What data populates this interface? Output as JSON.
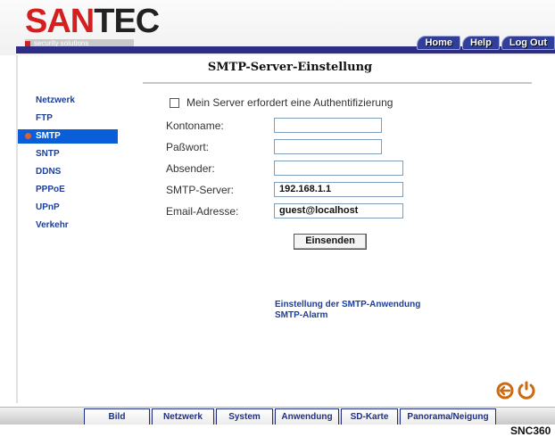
{
  "brand": {
    "logo_part1": "SAN",
    "logo_part2": "TEC",
    "tagline": "security solutions"
  },
  "top_nav": [
    {
      "label": "Home"
    },
    {
      "label": "Help"
    },
    {
      "label": "Log Out"
    }
  ],
  "page": {
    "title": "SMTP-Server-Einstellung"
  },
  "sidebar": {
    "items": [
      {
        "label": "Netzwerk"
      },
      {
        "label": "FTP"
      },
      {
        "label": "SMTP",
        "active": true
      },
      {
        "label": "SNTP"
      },
      {
        "label": "DDNS"
      },
      {
        "label": "PPPoE"
      },
      {
        "label": "UPnP"
      },
      {
        "label": "Verkehr"
      }
    ]
  },
  "form": {
    "auth_label": "Mein Server erfordert eine Authentifizierung",
    "auth_checked": false,
    "fields": [
      {
        "label": "Kontoname:",
        "value": ""
      },
      {
        "label": "Paßwort:",
        "value": ""
      },
      {
        "label": "Absender:",
        "value": ""
      },
      {
        "label": "SMTP-Server:",
        "value": "192.168.1.1"
      },
      {
        "label": "Email-Adresse:",
        "value": "guest@localhost"
      }
    ],
    "submit_label": "Einsenden"
  },
  "links": {
    "app": "Einstellung der SMTP-Anwendung",
    "alarm": "SMTP-Alarm"
  },
  "bottom_nav": [
    {
      "label": "Bild"
    },
    {
      "label": "Netzwerk"
    },
    {
      "label": "System"
    },
    {
      "label": "Anwendung"
    },
    {
      "label": "SD-Karte"
    },
    {
      "label": "Panorama/Neigung"
    }
  ],
  "model": "SNC360",
  "icons": {
    "back": "back-arrow-icon",
    "refresh": "refresh-icon"
  },
  "colors": {
    "accent_red": "#d51f1f",
    "link_blue": "#1c3e9c",
    "active_blue": "#0a5fd8",
    "nav_dark": "#2d2d86"
  }
}
